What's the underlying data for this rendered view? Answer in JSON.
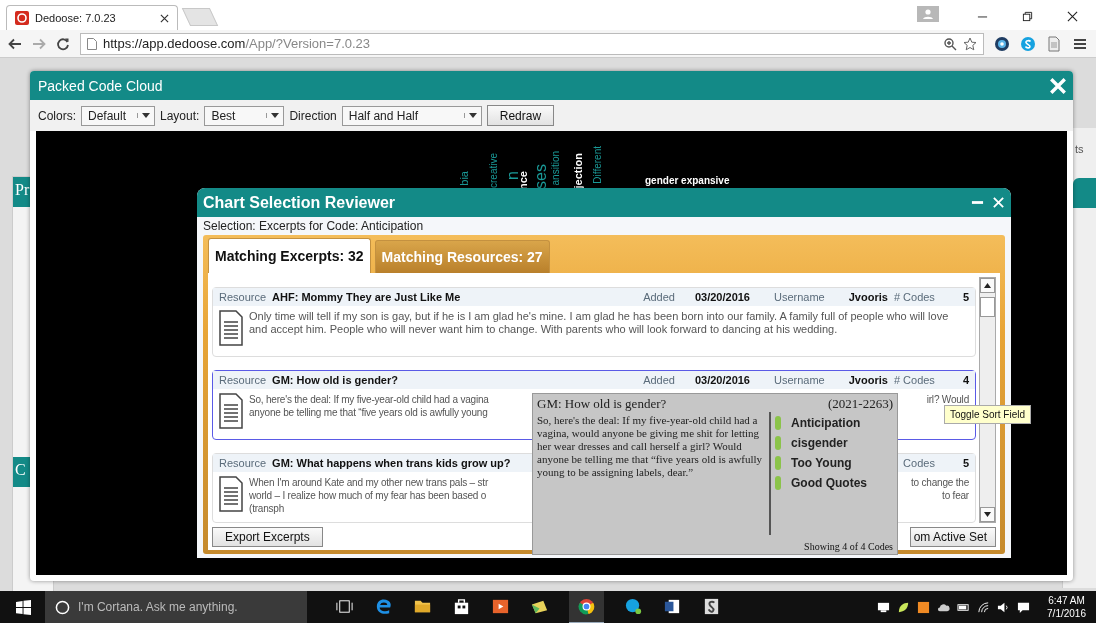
{
  "browser": {
    "tab_title": "Dedoose: 7.0.23",
    "url_host": "https://app.dedoose.com",
    "url_path": "/App/?Version=7.0.23"
  },
  "background_page": {
    "left_header": "Pr",
    "left_lower_header": "C",
    "right_fragment": "ts"
  },
  "code_cloud": {
    "title": "Packed Code Cloud",
    "controls": [
      {
        "label": "Colors:",
        "value": "Default"
      },
      {
        "label": "Layout:",
        "value": "Best"
      },
      {
        "label": "Direction",
        "value": "Half and Half"
      }
    ],
    "redraw": "Redraw",
    "words": [
      {
        "text": "bia",
        "vertical": true,
        "color": "#1a9a98"
      },
      {
        "text": "creative",
        "vertical": true,
        "color": "#1a9a98"
      },
      {
        "text": "n",
        "vertical": true,
        "color": "#1a9a98"
      },
      {
        "text": "nce",
        "vertical": true,
        "color": "#ffffff"
      },
      {
        "text": "ses",
        "vertical": true,
        "color": "#1a9a98"
      },
      {
        "text": "ansition",
        "vertical": true,
        "color": "#1a9a98"
      },
      {
        "text": "jection",
        "vertical": true,
        "color": "#ffffff"
      },
      {
        "text": "Different",
        "vertical": true,
        "color": "#1a9a98"
      },
      {
        "text": "gender expansive",
        "vertical": false,
        "color": "#ffffff"
      }
    ]
  },
  "reviewer": {
    "title": "Chart Selection Reviewer",
    "selection": "Selection: Excerpts for Code: Anticipation",
    "tabs": [
      {
        "label": "Matching Excerpts: 32",
        "selected": true
      },
      {
        "label": "Matching Resources: 27",
        "selected": false
      }
    ],
    "excerpts": [
      {
        "resource_label": "Resource",
        "resource": "AHF: Mommy They are Just Like Me",
        "added_label": "Added",
        "added": "03/20/2016",
        "username_label": "Username",
        "username": "Jvooris",
        "codes_label": "# Codes",
        "codes": "5",
        "selected": false,
        "text": "Only time will tell if my son is gay, but if he is I am glad he's mine.  I am glad he has been born into our family.  A family full of people who will love and accept him.  People who will never want him to change.  With parents who will look forward to dancing at his wedding."
      },
      {
        "resource_label": "Resource",
        "resource": "GM: How old is gender?",
        "added_label": "Added",
        "added": "03/20/2016",
        "username_label": "Username",
        "username": "Jvooris",
        "codes_label": "# Codes",
        "codes": "4",
        "selected": true,
        "lines": [
          {
            "left": "So, here's the deal: If my five-year-old child had a vagina",
            "right": "irl?  Would"
          },
          {
            "left": "anyone be telling me that “five years old is awfully young"
          }
        ]
      },
      {
        "resource_label": "Resource",
        "resource": "GM: What happens when trans kids grow up?",
        "codes_label": "Codes",
        "codes": "5",
        "selected": false,
        "lines": [
          {
            "left": "When I'm around Kate and my other new trans pals – str",
            "right": "to change the"
          },
          {
            "left": "world – I realize how much of my fear has been based o",
            "right": "to fear"
          },
          {
            "left": "(transph"
          }
        ]
      }
    ],
    "buttons": [
      "Export Excerpts",
      "om Active Set"
    ]
  },
  "excerpt_popup": {
    "title": "GM: How old is gender?",
    "range": "(2021-2263)",
    "text": "So, here's the deal: If my five-year-old child had a vagina, would anyone be giving me shit for letting her wear dresses and call herself a girl?  Would anyone be telling me that “five years old is awfully young to be assigning labels, dear.”",
    "codes": [
      "Anticipation",
      "cisgender",
      "Too Young",
      "Good Quotes"
    ],
    "footer": "Showing 4 of 4 Codes"
  },
  "sort_tooltip": "Toggle Sort Field",
  "taskbar": {
    "search_placeholder": "I'm Cortana. Ask me anything.",
    "time": "6:47 AM",
    "date": "7/1/2016"
  }
}
